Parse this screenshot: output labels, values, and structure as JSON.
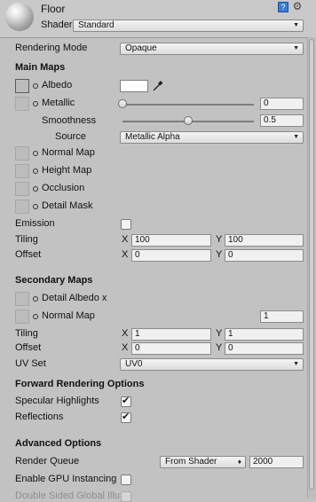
{
  "header": {
    "object_name": "Floor",
    "shader_label": "Shader",
    "shader_value": "Standard",
    "help_icon": "book-help-icon",
    "settings_icon": "gear-icon"
  },
  "rendering_mode": {
    "label": "Rendering Mode",
    "value": "Opaque"
  },
  "main_maps": {
    "title": "Main Maps",
    "albedo": {
      "label": "Albedo",
      "color": "#ffffff"
    },
    "metallic": {
      "label": "Metallic",
      "value": "0",
      "level": 0.0
    },
    "smoothness": {
      "label": "Smoothness",
      "value": "0.5",
      "level": 0.5
    },
    "source": {
      "label": "Source",
      "value": "Metallic Alpha"
    },
    "normal_map": {
      "label": "Normal Map"
    },
    "height_map": {
      "label": "Height Map"
    },
    "occlusion": {
      "label": "Occlusion"
    },
    "detail_mask": {
      "label": "Detail Mask"
    },
    "emission": {
      "label": "Emission",
      "checked": false
    },
    "tiling": {
      "label": "Tiling",
      "x_axis": "X",
      "x": "100",
      "y_axis": "Y",
      "y": "100"
    },
    "offset": {
      "label": "Offset",
      "x_axis": "X",
      "x": "0",
      "y_axis": "Y",
      "y": "0"
    }
  },
  "secondary_maps": {
    "title": "Secondary Maps",
    "detail_albedo": {
      "label": "Detail Albedo x"
    },
    "normal_map": {
      "label": "Normal Map",
      "value": "1"
    },
    "tiling": {
      "label": "Tiling",
      "x_axis": "X",
      "x": "1",
      "y_axis": "Y",
      "y": "1"
    },
    "offset": {
      "label": "Offset",
      "x_axis": "X",
      "x": "0",
      "y_axis": "Y",
      "y": "0"
    },
    "uv_set": {
      "label": "UV Set",
      "value": "UV0"
    }
  },
  "forward_rendering": {
    "title": "Forward Rendering Options",
    "specular": {
      "label": "Specular Highlights",
      "checked": true
    },
    "reflections": {
      "label": "Reflections",
      "checked": true
    }
  },
  "advanced": {
    "title": "Advanced Options",
    "render_queue": {
      "label": "Render Queue",
      "mode": "From Shader",
      "value": "2000"
    },
    "gpu_instancing": {
      "label": "Enable GPU Instancing",
      "checked": false
    },
    "double_sided": {
      "label": "Double Sided Global Illumination"
    }
  }
}
